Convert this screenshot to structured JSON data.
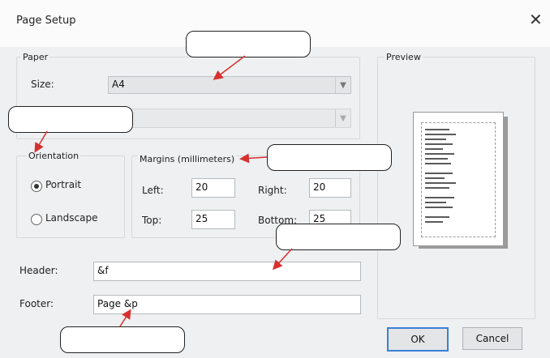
{
  "dialog": {
    "title": "Page Setup",
    "close_glyph": "✕",
    "close_icon": "close-icon"
  },
  "paper": {
    "group_label": "Paper",
    "size_label": "Size:",
    "size_value": "A4",
    "source_value": ""
  },
  "orientation": {
    "group_label": "Orientation",
    "portrait_label": "Portrait",
    "landscape_label": "Landscape",
    "selected": "Portrait"
  },
  "margins": {
    "group_label": "Margins (millimeters)",
    "left_label": "Left:",
    "left_value": "20",
    "right_label": "Right:",
    "right_value": "20",
    "top_label": "Top:",
    "top_value": "25",
    "bottom_label": "Bottom:",
    "bottom_value": "25"
  },
  "header_footer": {
    "header_label": "Header:",
    "header_value": "&f",
    "footer_label": "Footer:",
    "footer_value": "Page &p"
  },
  "preview": {
    "group_label": "Preview"
  },
  "buttons": {
    "ok_label": "OK",
    "cancel_label": "Cancel"
  },
  "colors": {
    "annotation_arrow": "#d83030",
    "default_button_border": "#3b7fd6"
  }
}
